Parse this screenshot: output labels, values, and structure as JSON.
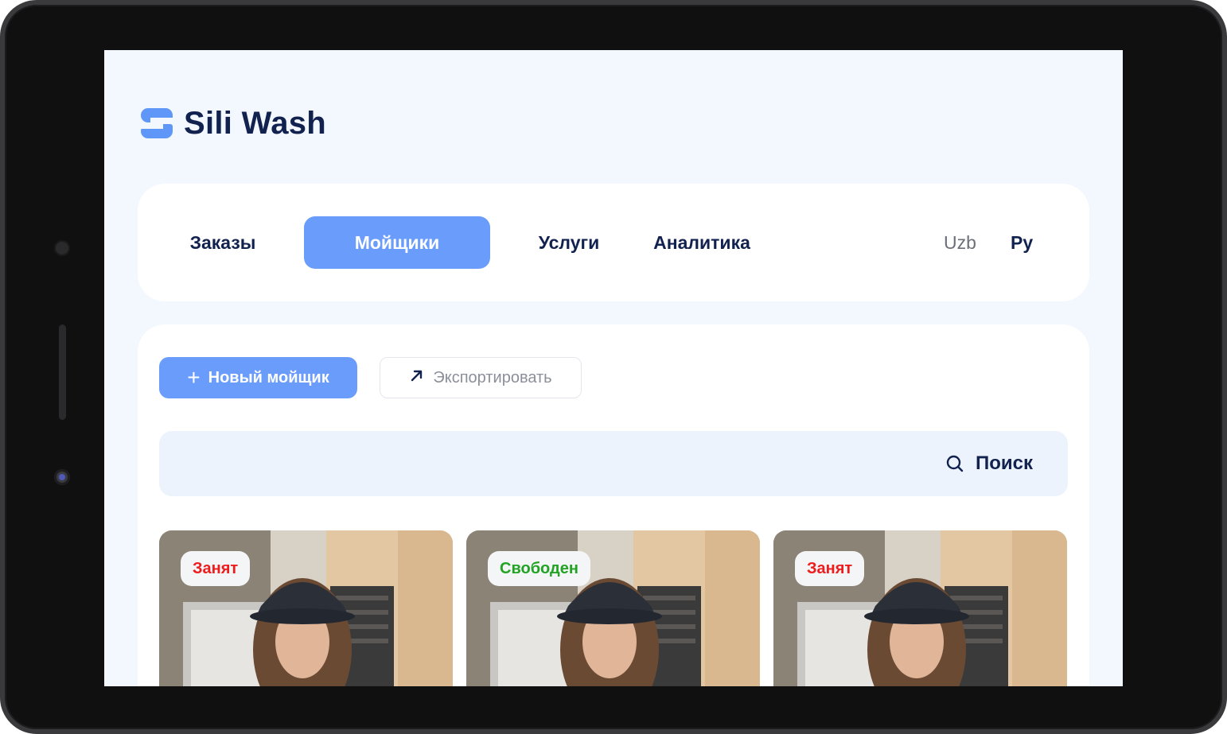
{
  "app": {
    "name": "Sili Wash"
  },
  "nav": {
    "items": [
      {
        "label": "Заказы",
        "active": false
      },
      {
        "label": "Мойщики",
        "active": true
      },
      {
        "label": "Услуги",
        "active": false
      },
      {
        "label": "Аналитика",
        "active": false
      }
    ],
    "languages": [
      {
        "label": "Uzb",
        "selected": false
      },
      {
        "label": "Ру",
        "selected": true
      }
    ]
  },
  "toolbar": {
    "new_label": "Новый мойщик",
    "export_label": "Экспортировать"
  },
  "search": {
    "label": "Поиск"
  },
  "cards": [
    {
      "status": "Занят",
      "status_color": "#ee1d1d"
    },
    {
      "status": "Свободен",
      "status_color": "#22a323"
    },
    {
      "status": "Занят",
      "status_color": "#ee1d1d"
    }
  ],
  "colors": {
    "accent": "#6a9dfb",
    "text_dark": "#12224f",
    "background": "#f3f7fe"
  }
}
